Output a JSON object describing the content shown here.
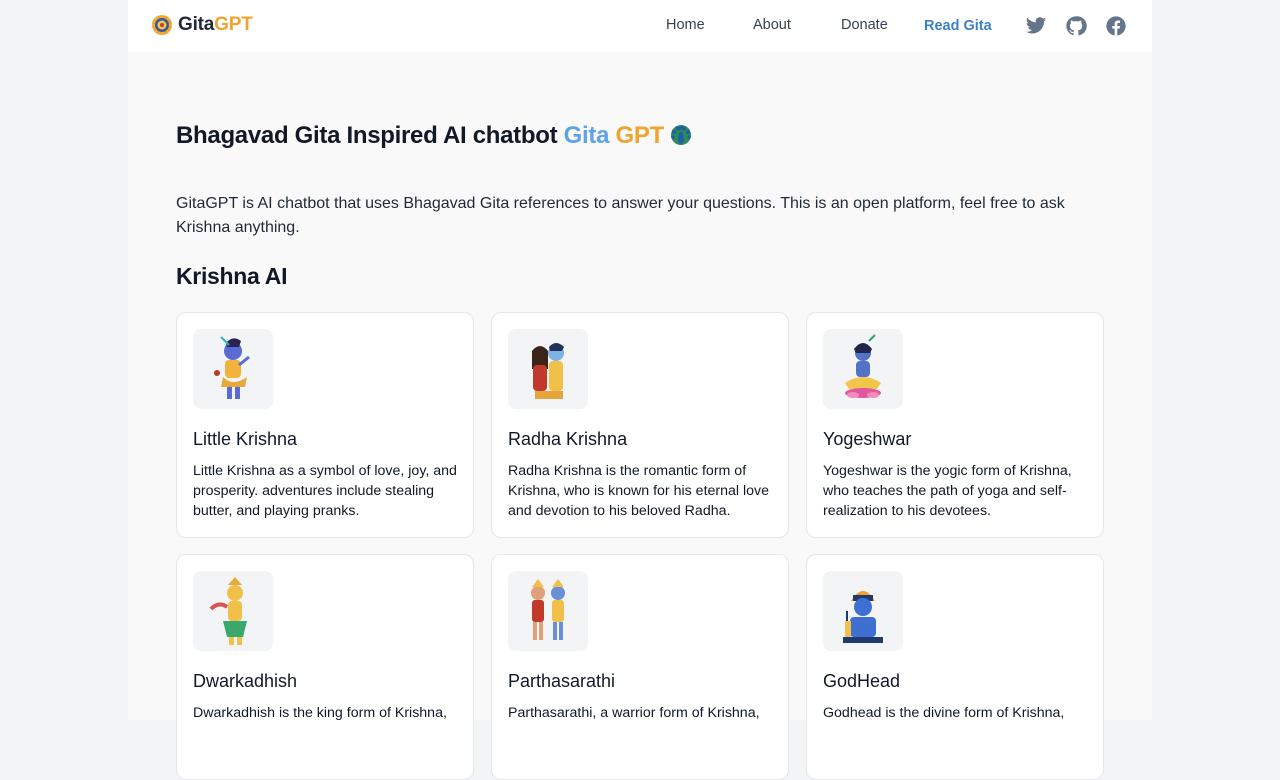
{
  "header": {
    "logo": {
      "gita": "Gita",
      "gpt": "GPT"
    },
    "nav": [
      {
        "label": "Home"
      },
      {
        "label": "About"
      },
      {
        "label": "Donate"
      },
      {
        "label": "Read Gita"
      }
    ],
    "social": [
      "twitter-icon",
      "github-icon",
      "facebook-icon"
    ]
  },
  "hero": {
    "title_prefix": "Bhagavad Gita Inspired AI chatbot",
    "title_gita": "Gita",
    "title_gpt": "GPT",
    "intro": "GitaGPT is AI chatbot that uses Bhagavad Gita references to answer your questions. This is an open platform, feel free to ask Krishna anything."
  },
  "section": {
    "title": "Krishna AI"
  },
  "cards": [
    {
      "title": "Little Krishna",
      "description": "Little Krishna as a symbol of love, joy, and prosperity. adventures include stealing butter, and playing pranks.",
      "icon": "little-krishna-illustration"
    },
    {
      "title": "Radha Krishna",
      "description": "Radha Krishna is the romantic form of Krishna, who is known for his eternal love and devotion to his beloved Radha.",
      "icon": "radha-krishna-illustration"
    },
    {
      "title": "Yogeshwar",
      "description": "Yogeshwar is the yogic form of Krishna, who teaches the path of yoga and self-realization to his devotees.",
      "icon": "yogeshwar-illustration"
    },
    {
      "title": "Dwarkadhish",
      "description": "Dwarkadhish is the king form of Krishna,",
      "icon": "dwarkadhish-illustration"
    },
    {
      "title": "Parthasarathi",
      "description": "Parthasarathi, a warrior form of Krishna,",
      "icon": "parthasarathi-illustration"
    },
    {
      "title": "GodHead",
      "description": "Godhead is the divine form of Krishna,",
      "icon": "godhead-illustration"
    }
  ],
  "colors": {
    "accent_blue": "#3b82c4",
    "gita_blue": "#5fa3e6",
    "gpt_orange": "#f0a430"
  }
}
